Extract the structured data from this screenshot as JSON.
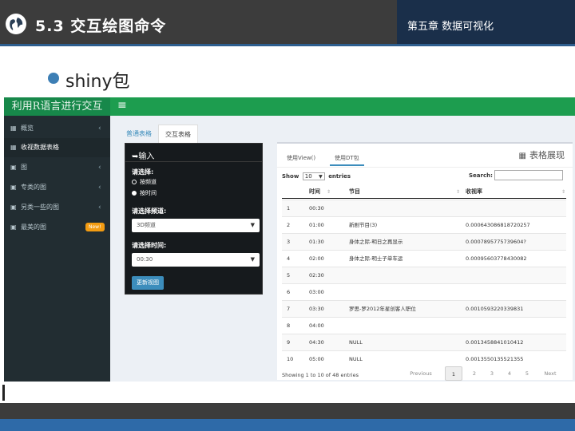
{
  "slide": {
    "title": "5.3  交互绘图命令",
    "chapter": "第五章 数据可视化",
    "bullet": "shiny包"
  },
  "colors": {
    "header_bg": "#3c3c3c",
    "accent_blue": "#2e6aa8",
    "app_green": "#1d9d4f",
    "sidebar_bg": "#222d32"
  },
  "app": {
    "title": "利用R语言进行交互",
    "menu_icon": "hamburger-icon",
    "sidebar": [
      {
        "icon": "grid-icon",
        "label": "概览",
        "chevron": "‹",
        "badge": ""
      },
      {
        "icon": "grid-icon",
        "label": "收视数据表格",
        "chevron": "",
        "badge": ""
      },
      {
        "icon": "image-icon",
        "label": "图",
        "chevron": "‹",
        "badge": ""
      },
      {
        "icon": "image-icon",
        "label": "专类的图",
        "chevron": "‹",
        "badge": ""
      },
      {
        "icon": "image-icon",
        "label": "另类一些的图",
        "chevron": "‹",
        "badge": ""
      },
      {
        "icon": "image-icon",
        "label": "最美的图",
        "chevron": "",
        "badge": "New!"
      }
    ],
    "tabs": [
      "普通表格",
      "交互表格"
    ],
    "input_panel": {
      "title": "输入",
      "choose_label": "请选择:",
      "radio_options": [
        "按频道",
        "按时间"
      ],
      "channel_label": "请选择频道:",
      "channel_value": "3D频道",
      "time_label": "请选择时间:",
      "time_value": "00:30",
      "update_button": "更新视图"
    },
    "table_box": {
      "tabs": [
        "使用View()",
        "使用DT包"
      ],
      "title": "表格展现",
      "show_prefix": "Show",
      "show_value": "10",
      "show_suffix": "entries",
      "search_label": "Search:",
      "columns": [
        "",
        "时间",
        "节目",
        "收视率"
      ],
      "rows": [
        [
          "1",
          "00:30",
          "",
          ""
        ],
        [
          "2",
          "01:00",
          "新剧节目(3)",
          "0.000643086818720257"
        ],
        [
          "3",
          "01:30",
          "身体之际-明日之再显示",
          "0.0007895775739604?"
        ],
        [
          "4",
          "02:00",
          "身体之际-明士子单车运",
          "0.00095603778430082"
        ],
        [
          "5",
          "02:30",
          "",
          ""
        ],
        [
          "6",
          "03:00",
          "",
          ""
        ],
        [
          "7",
          "03:30",
          "罗思-罗2012年星创客人职位",
          "0.0010593220339831"
        ],
        [
          "8",
          "04:00",
          "",
          ""
        ],
        [
          "9",
          "04:30",
          "NULL",
          "0.0013458841010412"
        ],
        [
          "10",
          "05:00",
          "NULL",
          "0.0013550135521355"
        ]
      ],
      "info": "Showing 1 to 10 of 48 entries",
      "pager": [
        "Previous",
        "1",
        "2",
        "3",
        "4",
        "5",
        "Next"
      ]
    }
  }
}
